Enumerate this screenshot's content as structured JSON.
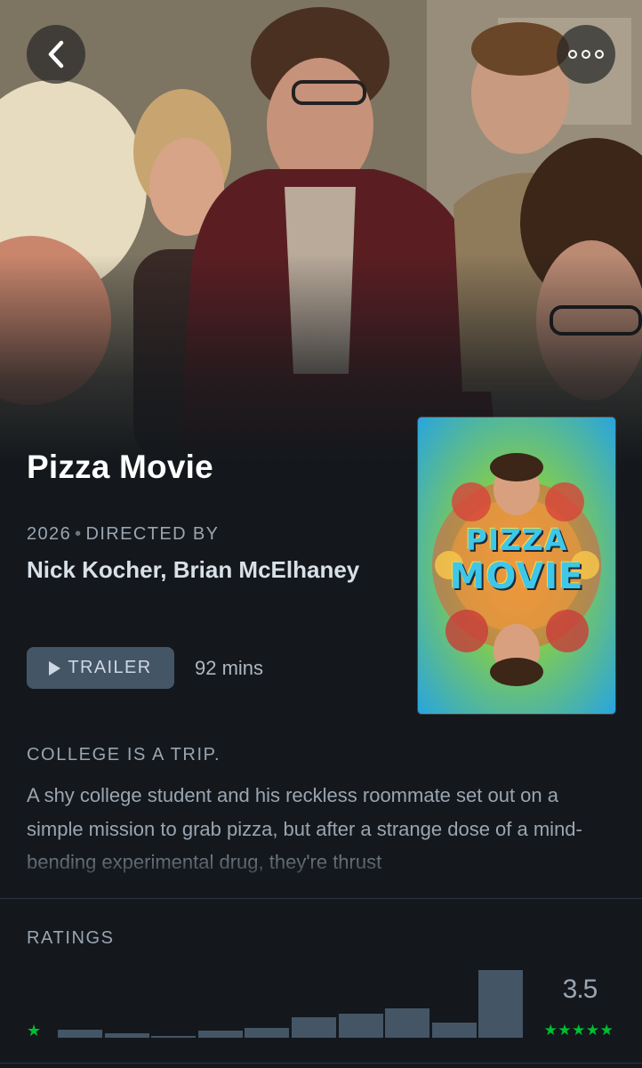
{
  "hero": {
    "back_icon": "chevron-left-icon",
    "more_icon": "more-dots-icon"
  },
  "film": {
    "title": "Pizza Movie",
    "year": "2026",
    "directed_by_label": "DIRECTED BY",
    "directors": "Nick Kocher, Brian McElhaney",
    "trailer_label": "TRAILER",
    "runtime": "92 mins",
    "tagline": "COLLEGE IS A TRIP.",
    "synopsis": "A shy college student and his reckless roommate set out on a simple mission to grab pizza, but after a strange dose of a mind-bending experimental drug, they're thrust"
  },
  "poster": {
    "line1": "PIZZA",
    "line2": "MOVIE"
  },
  "ratings": {
    "label": "RATINGS",
    "average": "3.5",
    "min_star": "★",
    "max_stars": "★★★★★",
    "distribution": [
      0.12,
      0.07,
      0.02,
      0.1,
      0.15,
      0.3,
      0.36,
      0.44,
      0.22,
      1.0
    ]
  },
  "colors": {
    "background": "#14181c",
    "accent_green": "#00c030",
    "button": "#445566",
    "muted_text": "#9aa5b1"
  }
}
